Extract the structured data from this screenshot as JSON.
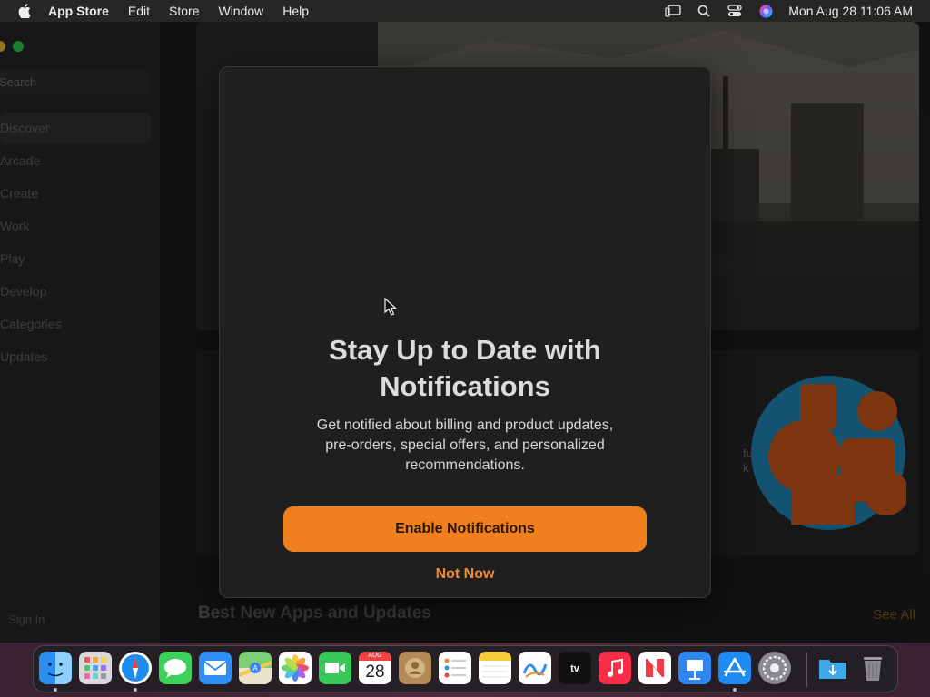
{
  "menubar": {
    "app_name": "App Store",
    "menus": [
      "Edit",
      "Store",
      "Window",
      "Help"
    ],
    "clock": "Mon Aug 28  11:06 AM",
    "status_icons": [
      "stage-manager-icon",
      "spotlight-search-icon",
      "control-center-icon",
      "siri-icon"
    ]
  },
  "sidebar": {
    "search_placeholder": "Search",
    "items": [
      {
        "label": "Discover",
        "active": true
      },
      {
        "label": "Arcade"
      },
      {
        "label": "Create"
      },
      {
        "label": "Work"
      },
      {
        "label": "Play"
      },
      {
        "label": "Develop"
      },
      {
        "label": "Categories"
      },
      {
        "label": "Updates"
      }
    ],
    "sign_in": "Sign In"
  },
  "main": {
    "feature_text_line1": "ful",
    "feature_text_line2": "k",
    "section_title": "Best New Apps and Updates",
    "see_all": "See All"
  },
  "modal": {
    "title_line1": "Stay Up to Date with",
    "title_line2": "Notifications",
    "body_line1": "Get notified about billing and product updates,",
    "body_line2": "pre-orders, special offers, and personalized",
    "body_line3": "recommendations.",
    "primary_button": "Enable Notifications",
    "secondary_button": "Not Now"
  },
  "dock": {
    "calendar_month": "AUG",
    "calendar_day": "28",
    "apps": [
      "Finder",
      "Launchpad",
      "Safari",
      "Messages",
      "Mail",
      "Maps",
      "Photos",
      "FaceTime",
      "Calendar",
      "Contacts",
      "Reminders",
      "Notes",
      "Freeform",
      "TV",
      "Music",
      "News",
      "Keynote",
      "App Store",
      "System Settings",
      "Downloads",
      "Trash"
    ]
  },
  "colors": {
    "accent": "#f0801e",
    "modal_bg": "#1f1f1f"
  }
}
